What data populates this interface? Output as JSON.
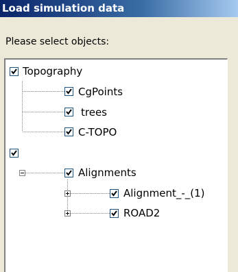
{
  "window": {
    "title": "Load simulation data"
  },
  "prompt": "Please select objects:",
  "tree": {
    "topography": {
      "label": "Topography",
      "checked": true
    },
    "cgpoints": {
      "label": "CgPoints",
      "checked": true
    },
    "trees": {
      "label": "trees",
      "checked": true
    },
    "ctopo": {
      "label": "C-TOPO",
      "checked": true
    },
    "group2": {
      "label": "",
      "checked": true
    },
    "alignments": {
      "label": "Alignments",
      "checked": true
    },
    "alignment1": {
      "label": "Alignment_-_(1)",
      "checked": true
    },
    "road2": {
      "label": "ROAD2",
      "checked": true
    }
  }
}
